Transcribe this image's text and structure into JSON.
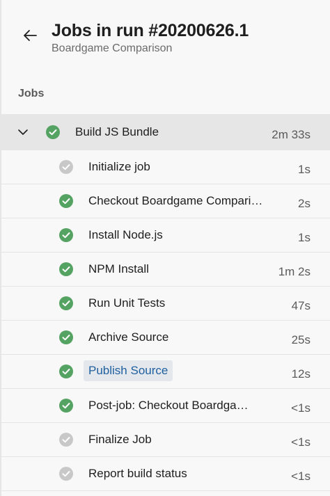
{
  "header": {
    "title": "Jobs in run #20200626.1",
    "subtitle": "Boardgame Comparison",
    "back_icon": "arrow-left-icon"
  },
  "section": {
    "label": "Jobs"
  },
  "colors": {
    "success": "#55a362",
    "pending": "#c8c8c8",
    "link": "#1f5fa0",
    "group_bg": "#e6e6e6"
  },
  "job": {
    "name": "Build JS Bundle",
    "duration": "2m 33s",
    "status": "success",
    "expanded": true
  },
  "steps": [
    {
      "name": "Initialize job",
      "duration": "1s",
      "status": "skipped"
    },
    {
      "name": "Checkout Boardgame Compari…",
      "duration": "2s",
      "status": "success"
    },
    {
      "name": "Install Node.js",
      "duration": "1s",
      "status": "success"
    },
    {
      "name": "NPM Install",
      "duration": "1m 2s",
      "status": "success"
    },
    {
      "name": "Run Unit Tests",
      "duration": "47s",
      "status": "success"
    },
    {
      "name": "Archive Source",
      "duration": "25s",
      "status": "success"
    },
    {
      "name": "Publish Source",
      "duration": "12s",
      "status": "success",
      "selected": true
    },
    {
      "name": "Post-job: Checkout Boardga…",
      "duration": "<1s",
      "status": "success"
    },
    {
      "name": "Finalize Job",
      "duration": "<1s",
      "status": "skipped"
    },
    {
      "name": "Report build status",
      "duration": "<1s",
      "status": "skipped"
    }
  ]
}
